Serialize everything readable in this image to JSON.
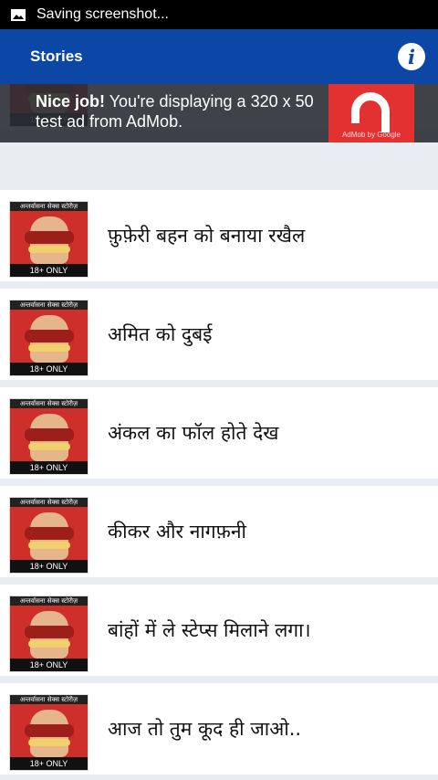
{
  "status_bar": {
    "text": "Saving screenshot...",
    "icon": "image-icon"
  },
  "app_bar": {
    "title": "Stories",
    "info_icon": "info-icon",
    "info_glyph": "i"
  },
  "ad": {
    "headline": "Nice job!",
    "body": " You're displaying a 320 x 50 test ad from AdMob.",
    "brand": "AdMob by Google"
  },
  "thumb": {
    "top_label": "अन्तर्वासना सेक्स स्टोरीज़",
    "badge": "18+ ONLY"
  },
  "stories": [
    {
      "title": ""
    },
    {
      "title": "फ़ुफ़ेरी बहन को बनाया रखैल"
    },
    {
      "title": "अमित को दुबई"
    },
    {
      "title": "अंकल का फॉल होते देख"
    },
    {
      "title": "कीकर और नागफ़नी"
    },
    {
      "title": "बांहों में ले स्टेप्स मिलाने लगा।"
    },
    {
      "title": "आज तो तुम कूद ही जाओ.."
    }
  ]
}
